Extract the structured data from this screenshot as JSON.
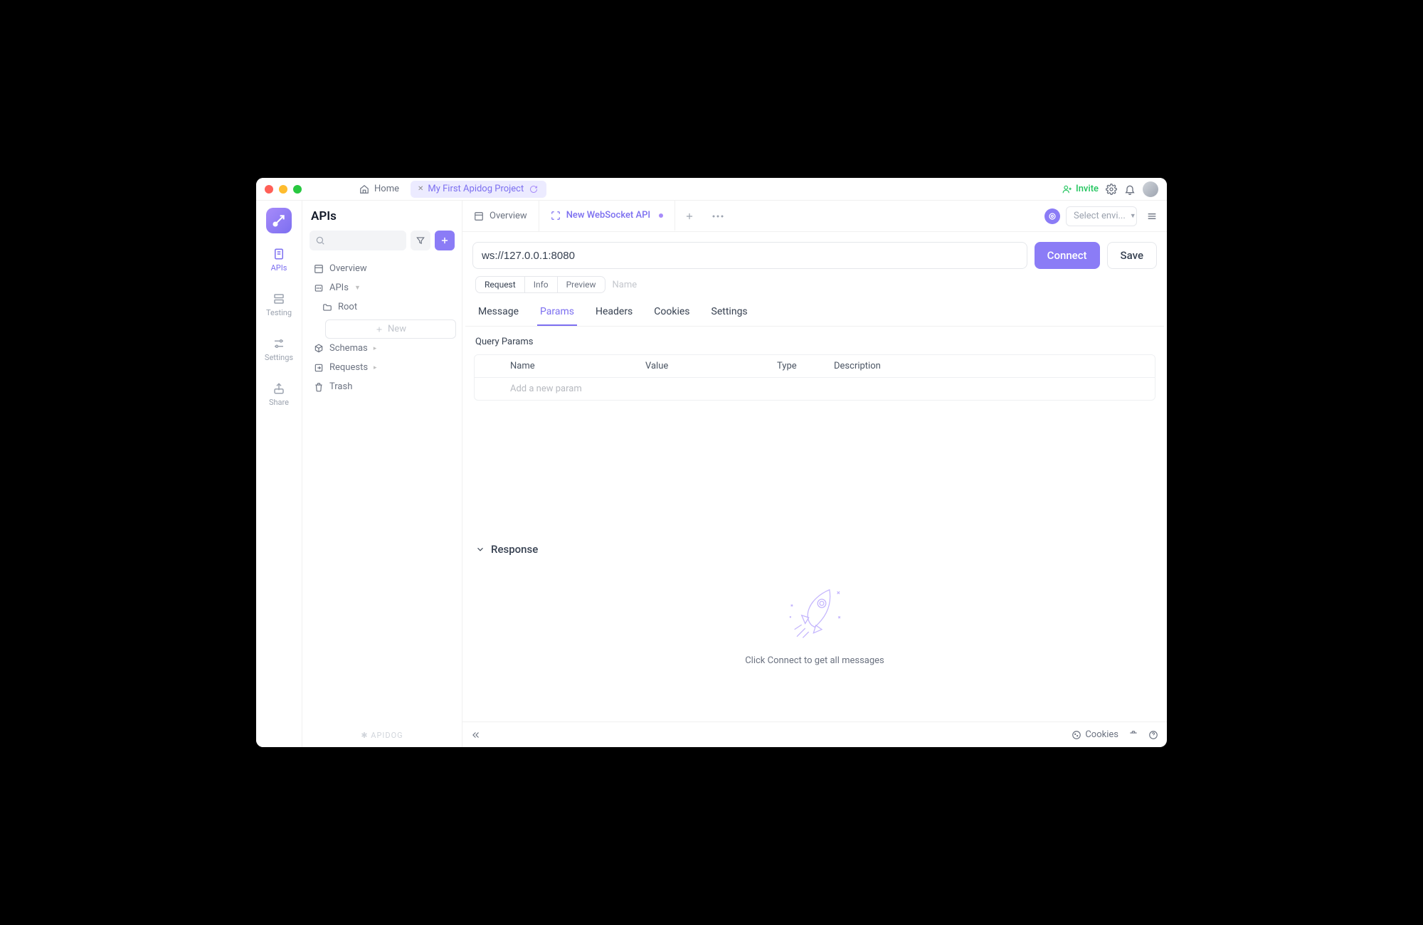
{
  "titlebar": {
    "home_label": "Home",
    "project_tab_label": "My First Apidog Project",
    "invite_label": "Invite"
  },
  "rail": {
    "items": [
      {
        "label": "APIs"
      },
      {
        "label": "Testing"
      },
      {
        "label": "Settings"
      },
      {
        "label": "Share"
      }
    ]
  },
  "sidebar": {
    "title": "APIs",
    "overview_label": "Overview",
    "apis_label": "APIs",
    "root_label": "Root",
    "new_label": "New",
    "schemas_label": "Schemas",
    "requests_label": "Requests",
    "trash_label": "Trash",
    "brand": "APIDOG"
  },
  "tabs": {
    "overview_label": "Overview",
    "active_label": "New WebSocket API",
    "env_placeholder": "Select envi..."
  },
  "request": {
    "url": "ws://127.0.0.1:8080",
    "connect_label": "Connect",
    "save_label": "Save",
    "seg": {
      "request": "Request",
      "info": "Info",
      "preview": "Preview"
    },
    "name_placeholder": "Name",
    "subtabs": {
      "message": "Message",
      "params": "Params",
      "headers": "Headers",
      "cookies": "Cookies",
      "settings": "Settings"
    }
  },
  "params": {
    "section_label": "Query Params",
    "columns": {
      "name": "Name",
      "value": "Value",
      "type": "Type",
      "description": "Description"
    },
    "add_placeholder": "Add a new param"
  },
  "response": {
    "title": "Response",
    "empty_hint": "Click Connect to get all messages"
  },
  "footer": {
    "cookies_label": "Cookies"
  }
}
